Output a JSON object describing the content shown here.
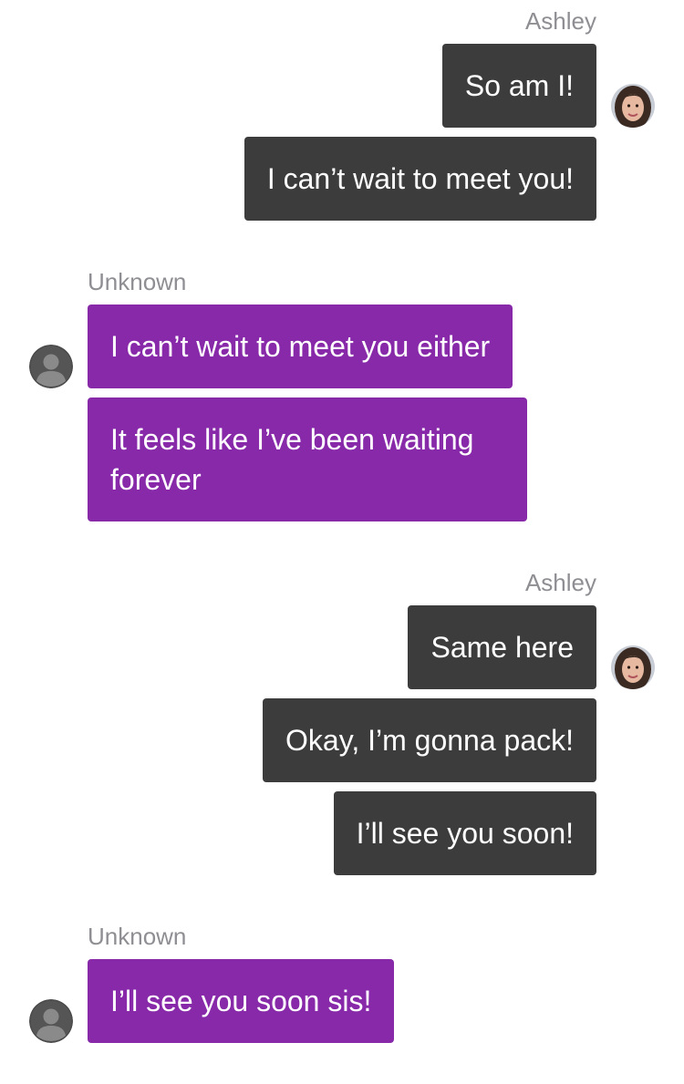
{
  "groups": [
    {
      "sender": "Ashley",
      "direction": "outgoing",
      "avatar_icon": "ashley-photo-avatar-icon",
      "messages": [
        "So am I!",
        "I can’t wait to meet you!"
      ]
    },
    {
      "sender": "Unknown",
      "direction": "incoming",
      "avatar_icon": "default-user-avatar-icon",
      "messages": [
        "I can’t wait to meet you either",
        "It feels like I’ve been waiting forever"
      ]
    },
    {
      "sender": "Ashley",
      "direction": "outgoing",
      "avatar_icon": "ashley-photo-avatar-icon",
      "messages": [
        "Same here",
        "Okay, I’m gonna pack!",
        "I’ll see you soon!"
      ]
    },
    {
      "sender": "Unknown",
      "direction": "incoming",
      "avatar_icon": "default-user-avatar-icon",
      "messages": [
        "I’ll see you soon sis!"
      ]
    }
  ],
  "colors": {
    "outgoing_bubble": "#3c3c3c",
    "incoming_bubble": "#8729a8",
    "sender_label": "#8e8e93",
    "background": "#ffffff"
  }
}
